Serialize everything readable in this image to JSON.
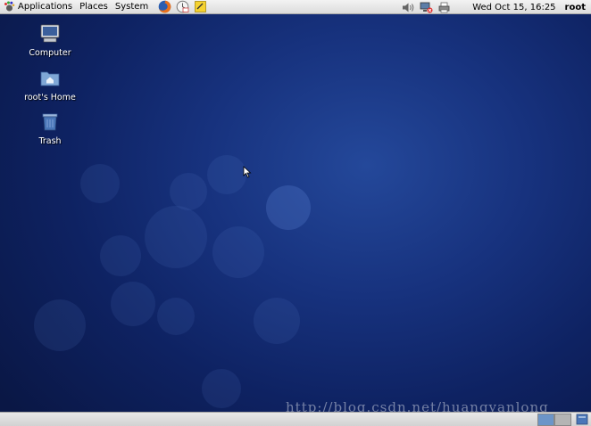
{
  "top_panel": {
    "menus": [
      "Applications",
      "Places",
      "System"
    ],
    "clock": "Wed Oct 15, 16:25",
    "user": "root"
  },
  "desktop": {
    "icons": [
      {
        "label": "Computer",
        "icon": "computer-icon"
      },
      {
        "label": "root's Home",
        "icon": "home-folder-icon"
      },
      {
        "label": "Trash",
        "icon": "trash-icon"
      }
    ],
    "watermark": "http://blog.csdn.net/huangyanlong"
  },
  "colors": {
    "desktop_bg": "#17327e",
    "panel_bg": "#e6e6e6"
  }
}
